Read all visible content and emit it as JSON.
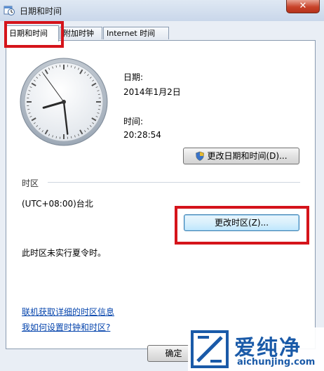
{
  "window": {
    "title": "日期和时间",
    "close_label": "✕"
  },
  "tabs": [
    {
      "label": "日期和时间",
      "active": true
    },
    {
      "label": "附加时钟",
      "active": false
    },
    {
      "label": "Internet 时间",
      "active": false
    }
  ],
  "clock": {
    "hour": 20,
    "minute": 28,
    "second": 54
  },
  "datetime": {
    "date_label": "日期:",
    "date_value": "2014年1月2日",
    "time_label": "时间:",
    "time_value": "20:28:54",
    "change_button": "更改日期和时间(D)..."
  },
  "timezone": {
    "section_label": "时区",
    "value": "(UTC+08:00)台北",
    "change_button": "更改时区(Z)...",
    "dst_note": "此时区未实行夏令时。"
  },
  "links": {
    "online_info": "联机获取详细的时区信息",
    "how_to_set": "我如何设置时钟和时区?"
  },
  "footer": {
    "ok_label": "确定"
  },
  "watermark": {
    "brand": "爱纯净",
    "url": "aichunjing.com"
  },
  "colors": {
    "highlight": "#d5141b",
    "link": "#0645ad",
    "watermark_blue": "#1a5aa8"
  }
}
